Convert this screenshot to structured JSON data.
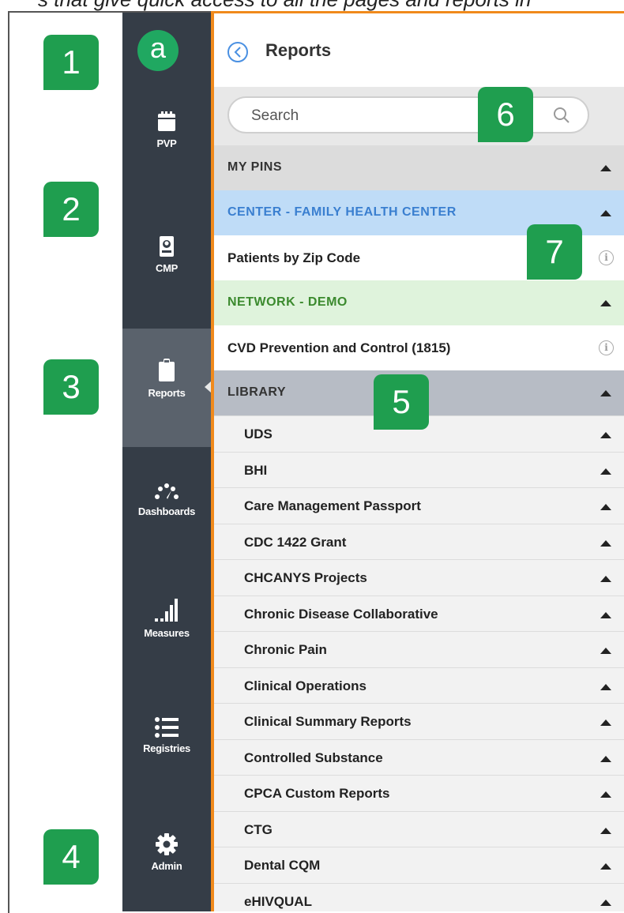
{
  "caption": "s that give quick access to all the pages and reports in",
  "logo": "a",
  "nav": [
    {
      "label": "PVP",
      "icon": "calendar-icon"
    },
    {
      "label": "CMP",
      "icon": "patient-card-icon"
    },
    {
      "label": "Reports",
      "icon": "clipboard-icon",
      "active": true
    },
    {
      "label": "Dashboards",
      "icon": "gauge-icon"
    },
    {
      "label": "Measures",
      "icon": "bars-icon"
    },
    {
      "label": "Registries",
      "icon": "list-icon"
    },
    {
      "label": "Admin",
      "icon": "gear-icon"
    }
  ],
  "panel": {
    "title": "Reports",
    "search_placeholder": "Search"
  },
  "sections": {
    "my_pins": "MY PINS",
    "center": "CENTER - FAMILY HEALTH CENTER",
    "center_item": "Patients by Zip Code",
    "network": "NETWORK - DEMO",
    "network_item": "CVD Prevention and Control (1815)",
    "library": "LIBRARY"
  },
  "library": [
    "UDS",
    "BHI",
    "Care Management Passport",
    "CDC 1422 Grant",
    "CHCANYS Projects",
    "Chronic Disease Collaborative",
    "Chronic Pain",
    "Clinical Operations",
    "Clinical Summary Reports",
    "Controlled Substance",
    "CPCA Custom Reports",
    "CTG",
    "Dental CQM",
    "eHIVQUAL"
  ],
  "badges": [
    "1",
    "2",
    "3",
    "4",
    "5",
    "6",
    "7"
  ],
  "colors": {
    "sidebar": "#353d47",
    "accent_green": "#20a861",
    "badge_green": "#1f9e4f",
    "panel_border": "#f08a1c",
    "center_bg": "#bfdcf7",
    "center_text": "#3a7fd0",
    "network_bg": "#dff3dc",
    "network_text": "#3b8a2e",
    "library_bg": "#b7bcc5"
  }
}
